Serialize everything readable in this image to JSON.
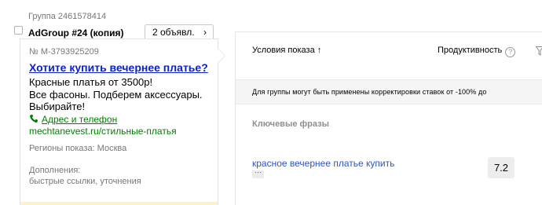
{
  "group": {
    "id_label": "Группа 2461578414",
    "name": "AdGroup #24 (копия)",
    "ads_button_label": "2 объявл.",
    "ads_button_chevron": "›"
  },
  "ad": {
    "number": "№ M-3793925209",
    "title": "Хотите купить вечернее платье?",
    "text": "Красные платья от 3500р!\nВсе фасоны. Подберем аксессуары. Выбирайте!",
    "contacts_label": "Адрес и телефон",
    "display_url": "mechtanevest.ru/стильные-платья",
    "regions": "Регионы показа: Москва",
    "extras_label": "Дополнения:",
    "extras_value": "быстрые ссылки, уточнения"
  },
  "table": {
    "col_conditions": "Условия показа ↑",
    "col_productivity": "Продуктивность",
    "help_glyph": "?",
    "notice": "Для группы могут быть применены корректировки ставок от -100% до",
    "section_heading": "Ключевые фразы",
    "rows": [
      {
        "phrase": "красное вечернее платье купить",
        "more": "···",
        "score": "7.2"
      }
    ]
  },
  "colors": {
    "title_link": "#0c22c7",
    "green_link": "#008000",
    "phrase_link": "#2c54c6",
    "muted": "#777777"
  },
  "icons": {
    "contacts": "phone-icon",
    "help": "help-icon",
    "filter": "filter-icon",
    "ads_chevron": "chevron-right-icon"
  }
}
